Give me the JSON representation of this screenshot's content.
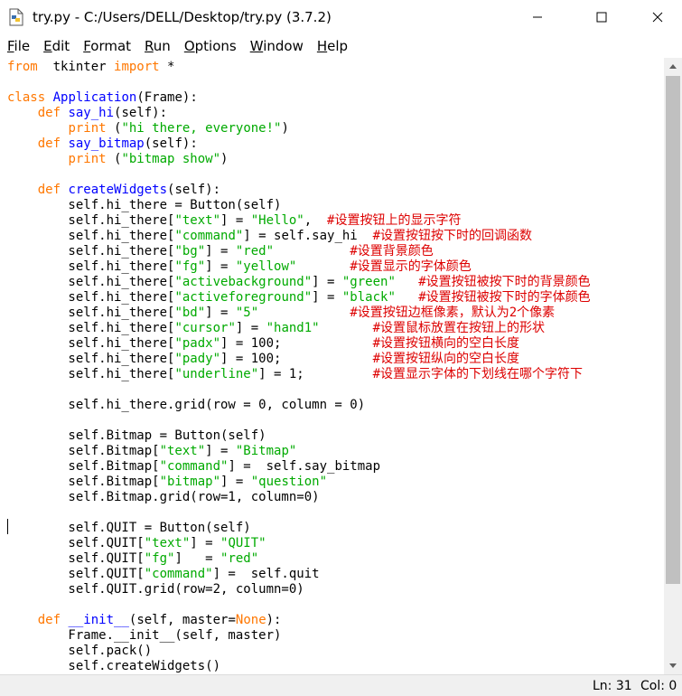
{
  "window": {
    "title": "try.py - C:/Users/DELL/Desktop/try.py (3.7.2)",
    "icon": "python-file-icon",
    "controls": [
      "minimize-icon",
      "maximize-icon",
      "close-icon"
    ]
  },
  "menu": [
    {
      "label": "File",
      "u": "F",
      "rest": "ile"
    },
    {
      "label": "Edit",
      "u": "E",
      "rest": "dit"
    },
    {
      "label": "Format",
      "u": "F",
      "rest": "ormat"
    },
    {
      "label": "Run",
      "u": "R",
      "rest": "un"
    },
    {
      "label": "Options",
      "u": "O",
      "rest": "ptions"
    },
    {
      "label": "Window",
      "u": "W",
      "rest": "indow"
    },
    {
      "label": "Help",
      "u": "H",
      "rest": "elp"
    }
  ],
  "colors": {
    "keyword": "#ff7700",
    "builtin_def": "#0000ff",
    "string": "#00aa00",
    "comment": "#dd0000"
  },
  "code_lines": [
    [
      [
        "kw",
        "from"
      ],
      [
        "",
        "  tkinter "
      ],
      [
        "kw",
        "import"
      ],
      [
        "",
        " *"
      ]
    ],
    [],
    [
      [
        "kw",
        "class"
      ],
      [
        "",
        " "
      ],
      [
        "fn",
        "Application"
      ],
      [
        "",
        "(Frame):"
      ]
    ],
    [
      [
        "",
        "    "
      ],
      [
        "kw",
        "def"
      ],
      [
        "",
        " "
      ],
      [
        "fn",
        "say_hi"
      ],
      [
        "",
        "(self):"
      ]
    ],
    [
      [
        "",
        "        "
      ],
      [
        "kw",
        "print"
      ],
      [
        "",
        " ("
      ],
      [
        "st",
        "\"hi there, everyone!\""
      ],
      [
        "",
        ")"
      ]
    ],
    [
      [
        "",
        "    "
      ],
      [
        "kw",
        "def"
      ],
      [
        "",
        " "
      ],
      [
        "fn",
        "say_bitmap"
      ],
      [
        "",
        "(self):"
      ]
    ],
    [
      [
        "",
        "        "
      ],
      [
        "kw",
        "print"
      ],
      [
        "",
        " ("
      ],
      [
        "st",
        "\"bitmap show\""
      ],
      [
        "",
        ")"
      ]
    ],
    [],
    [
      [
        "",
        "    "
      ],
      [
        "kw",
        "def"
      ],
      [
        "",
        " "
      ],
      [
        "fn",
        "createWidgets"
      ],
      [
        "",
        "(self):"
      ]
    ],
    [
      [
        "",
        "        self.hi_there = Button(self)"
      ]
    ],
    [
      [
        "",
        "        self.hi_there["
      ],
      [
        "st",
        "\"text\""
      ],
      [
        "",
        "] = "
      ],
      [
        "st",
        "\"Hello\""
      ],
      [
        "",
        ",  "
      ],
      [
        "cm",
        "#设置按钮上的显示字符"
      ]
    ],
    [
      [
        "",
        "        self.hi_there["
      ],
      [
        "st",
        "\"command\""
      ],
      [
        "",
        "] = self.say_hi  "
      ],
      [
        "cm",
        "#设置按钮按下时的回调函数"
      ]
    ],
    [
      [
        "",
        "        self.hi_there["
      ],
      [
        "st",
        "\"bg\""
      ],
      [
        "",
        "] = "
      ],
      [
        "st",
        "\"red\""
      ],
      [
        "",
        "          "
      ],
      [
        "cm",
        "#设置背景颜色"
      ]
    ],
    [
      [
        "",
        "        self.hi_there["
      ],
      [
        "st",
        "\"fg\""
      ],
      [
        "",
        "] = "
      ],
      [
        "st",
        "\"yellow\""
      ],
      [
        "",
        "       "
      ],
      [
        "cm",
        "#设置显示的字体颜色"
      ]
    ],
    [
      [
        "",
        "        self.hi_there["
      ],
      [
        "st",
        "\"activebackground\""
      ],
      [
        "",
        "] = "
      ],
      [
        "st",
        "\"green\""
      ],
      [
        "",
        "   "
      ],
      [
        "cm",
        "#设置按钮被按下时的背景颜色"
      ]
    ],
    [
      [
        "",
        "        self.hi_there["
      ],
      [
        "st",
        "\"activeforeground\""
      ],
      [
        "",
        "] = "
      ],
      [
        "st",
        "\"black\""
      ],
      [
        "",
        "   "
      ],
      [
        "cm",
        "#设置按钮被按下时的字体颜色"
      ]
    ],
    [
      [
        "",
        "        self.hi_there["
      ],
      [
        "st",
        "\"bd\""
      ],
      [
        "",
        "] = "
      ],
      [
        "st",
        "\"5\""
      ],
      [
        "",
        "            "
      ],
      [
        "cm",
        "#设置按钮边框像素，默认为2个像素"
      ]
    ],
    [
      [
        "",
        "        self.hi_there["
      ],
      [
        "st",
        "\"cursor\""
      ],
      [
        "",
        "] = "
      ],
      [
        "st",
        "\"hand1\""
      ],
      [
        "",
        "       "
      ],
      [
        "cm",
        "#设置鼠标放置在按钮上的形状"
      ]
    ],
    [
      [
        "",
        "        self.hi_there["
      ],
      [
        "st",
        "\"padx\""
      ],
      [
        "",
        "] = 100;            "
      ],
      [
        "cm",
        "#设置按钮横向的空白长度"
      ]
    ],
    [
      [
        "",
        "        self.hi_there["
      ],
      [
        "st",
        "\"pady\""
      ],
      [
        "",
        "] = 100;            "
      ],
      [
        "cm",
        "#设置按钮纵向的空白长度"
      ]
    ],
    [
      [
        "",
        "        self.hi_there["
      ],
      [
        "st",
        "\"underline\""
      ],
      [
        "",
        "] = 1;         "
      ],
      [
        "cm",
        "#设置显示字体的下划线在哪个字符下"
      ]
    ],
    [],
    [
      [
        "",
        "        self.hi_there.grid(row = 0, column = 0)"
      ]
    ],
    [],
    [
      [
        "",
        "        self.Bitmap = Button(self)"
      ]
    ],
    [
      [
        "",
        "        self.Bitmap["
      ],
      [
        "st",
        "\"text\""
      ],
      [
        "",
        "] = "
      ],
      [
        "st",
        "\"Bitmap\""
      ]
    ],
    [
      [
        "",
        "        self.Bitmap["
      ],
      [
        "st",
        "\"command\""
      ],
      [
        "",
        "] =  self.say_bitmap"
      ]
    ],
    [
      [
        "",
        "        self.Bitmap["
      ],
      [
        "st",
        "\"bitmap\""
      ],
      [
        "",
        "] = "
      ],
      [
        "st",
        "\"question\""
      ]
    ],
    [
      [
        "",
        "        self.Bitmap.grid(row=1, column=0)"
      ]
    ],
    [],
    [
      [
        "",
        "        self.QUIT = Button(self)"
      ]
    ],
    [
      [
        "",
        "        self.QUIT["
      ],
      [
        "st",
        "\"text\""
      ],
      [
        "",
        "] = "
      ],
      [
        "st",
        "\"QUIT\""
      ]
    ],
    [
      [
        "",
        "        self.QUIT["
      ],
      [
        "st",
        "\"fg\""
      ],
      [
        "",
        "]   = "
      ],
      [
        "st",
        "\"red\""
      ]
    ],
    [
      [
        "",
        "        self.QUIT["
      ],
      [
        "st",
        "\"command\""
      ],
      [
        "",
        "] =  self.quit"
      ]
    ],
    [
      [
        "",
        "        self.QUIT.grid(row=2, column=0)"
      ]
    ],
    [],
    [
      [
        "",
        "    "
      ],
      [
        "kw",
        "def"
      ],
      [
        "",
        " "
      ],
      [
        "fn",
        "__init__"
      ],
      [
        "",
        "(self, master="
      ],
      [
        "kw",
        "None"
      ],
      [
        "",
        "):"
      ]
    ],
    [
      [
        "",
        "        Frame.__init__(self, master)"
      ]
    ],
    [
      [
        "",
        "        self.pack()"
      ]
    ],
    [
      [
        "",
        "        self.createWidgets()"
      ]
    ]
  ],
  "status": {
    "line": "Ln: 31",
    "col": "Col: 0"
  }
}
